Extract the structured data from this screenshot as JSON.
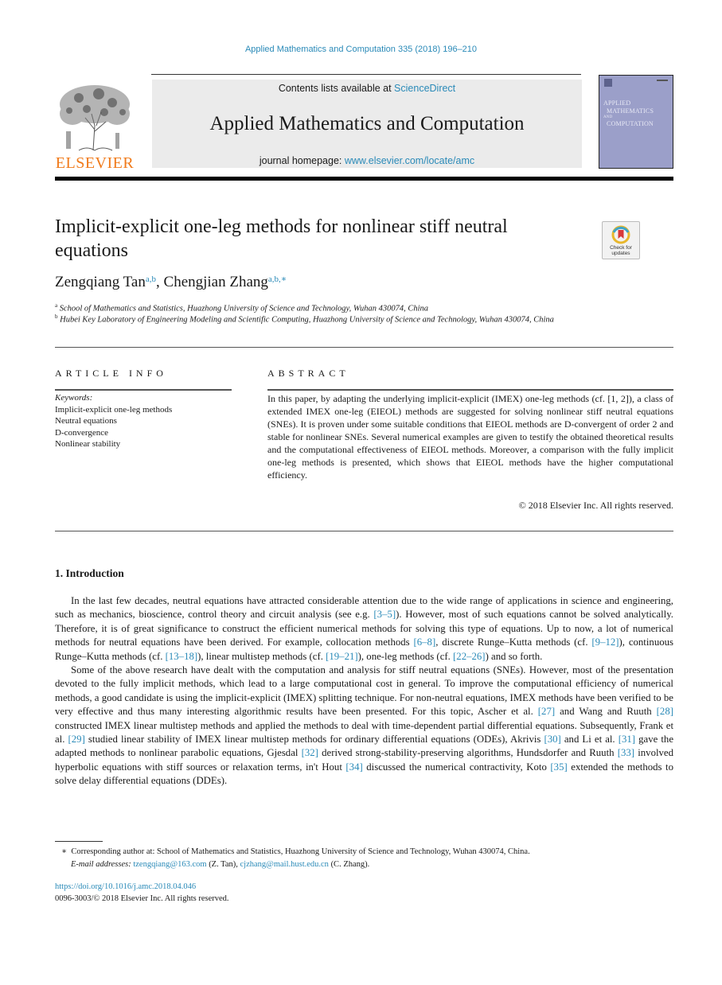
{
  "running_head": "Applied Mathematics and Computation 335 (2018) 196–210",
  "masthead": {
    "publisher_logo_text": "ELSEVIER",
    "contents_prefix": "Contents lists available at ",
    "contents_link": "ScienceDirect",
    "journal_title": "Applied Mathematics and Computation",
    "homepage_prefix": "journal homepage: ",
    "homepage_link": "www.elsevier.com/locate/amc",
    "cover_title_lines": [
      "APPLIED",
      "MATHEMATICS",
      "AND",
      "COMPUTATION"
    ]
  },
  "article": {
    "title": "Implicit-explicit one-leg methods for nonlinear stiff neutral equations",
    "crossmark_label": "Check for updates",
    "authors": [
      {
        "name": "Zengqiang Tan",
        "marks": "a,b"
      },
      {
        "name": "Chengjian Zhang",
        "marks": "a,b,∗"
      }
    ],
    "author_separator": ", ",
    "affiliations": [
      {
        "mark": "a",
        "text": "School of Mathematics and Statistics, Huazhong University of Science and Technology, Wuhan 430074, China"
      },
      {
        "mark": "b",
        "text": "Hubei Key Laboratory of Engineering Modeling and Scientific Computing, Huazhong University of Science and Technology, Wuhan 430074, China"
      }
    ]
  },
  "article_info": {
    "heading": "ARTICLE INFO",
    "keywords_label": "Keywords:",
    "keywords": [
      "Implicit-explicit one-leg methods",
      "Neutral equations",
      "D-convergence",
      "Nonlinear stability"
    ]
  },
  "abstract": {
    "heading": "ABSTRACT",
    "text": "In this paper, by adapting the underlying implicit-explicit (IMEX) one-leg methods (cf. [1, 2]), a class of extended IMEX one-leg (EIEOL) methods are suggested for solving nonlinear stiff neutral equations (SNEs). It is proven under some suitable conditions that EIEOL methods are D-convergent of order 2 and stable for nonlinear SNEs. Several numerical examples are given to testify the obtained theoretical results and the computational effectiveness of EIEOL methods. Moreover, a comparison with the fully implicit one-leg methods is presented, which shows that EIEOL methods have the higher computational efficiency.",
    "copyright": "© 2018 Elsevier Inc. All rights reserved."
  },
  "introduction": {
    "heading": "1. Introduction",
    "paragraphs": [
      [
        {
          "t": "In the last few decades, neutral equations have attracted considerable attention due to the wide range of applications in science and engineering, such as mechanics, bioscience, control theory and circuit analysis (see e.g. "
        },
        {
          "t": "[3–5]",
          "link": true
        },
        {
          "t": "). However, most of such equations cannot be solved analytically. Therefore, it is of great significance to construct the efficient numerical methods for solving this type of equations. Up to now, a lot of numerical methods for neutral equations have been derived. For example, collocation methods "
        },
        {
          "t": "[6–8]",
          "link": true
        },
        {
          "t": ", discrete Runge–Kutta methods (cf. "
        },
        {
          "t": "[9–12]",
          "link": true
        },
        {
          "t": "), continuous Runge–Kutta methods (cf. "
        },
        {
          "t": "[13–18]",
          "link": true
        },
        {
          "t": "), linear multistep methods (cf. "
        },
        {
          "t": "[19–21]",
          "link": true
        },
        {
          "t": "), one-leg methods (cf. "
        },
        {
          "t": "[22–26]",
          "link": true
        },
        {
          "t": ") and so forth."
        }
      ],
      [
        {
          "t": "Some of the above research have dealt with the computation and analysis for stiff neutral equations (SNEs). However, most of the presentation devoted to the fully implicit methods, which lead to a large computational cost in general. To improve the computational efficiency of numerical methods, a good candidate is using the implicit-explicit (IMEX) splitting technique. For non-neutral equations, IMEX methods have been verified to be very effective and thus many interesting algorithmic results have been presented. For this topic, Ascher et al. "
        },
        {
          "t": "[27]",
          "link": true
        },
        {
          "t": " and Wang and Ruuth "
        },
        {
          "t": "[28]",
          "link": true
        },
        {
          "t": " constructed IMEX linear multistep methods and applied the methods to deal with time-dependent partial differential equations. Subsequently, Frank et al. "
        },
        {
          "t": "[29]",
          "link": true
        },
        {
          "t": " studied linear stability of IMEX linear multistep methods for ordinary differential equations (ODEs), Akrivis "
        },
        {
          "t": "[30]",
          "link": true
        },
        {
          "t": " and Li et al. "
        },
        {
          "t": "[31]",
          "link": true
        },
        {
          "t": " gave the adapted methods to nonlinear parabolic equations, Gjesdal "
        },
        {
          "t": "[32]",
          "link": true
        },
        {
          "t": " derived strong-stability-preserving algorithms, Hundsdorfer and Ruuth "
        },
        {
          "t": "[33]",
          "link": true
        },
        {
          "t": " involved hyperbolic equations with stiff sources or relaxation terms, in't Hout "
        },
        {
          "t": "[34]",
          "link": true
        },
        {
          "t": " discussed the numerical contractivity, Koto "
        },
        {
          "t": "[35]",
          "link": true
        },
        {
          "t": " extended the methods to solve delay differential equations (DDEs)."
        }
      ]
    ]
  },
  "footnotes": {
    "corresponding_mark": "∗",
    "corresponding_text": "Corresponding author at: School of Mathematics and Statistics, Huazhong University of Science and Technology, Wuhan 430074, China.",
    "email_label": "E-mail addresses: ",
    "emails": [
      {
        "address": "tzengqiang@163.com",
        "who": " (Z. Tan), "
      },
      {
        "address": "cjzhang@mail.hust.edu.cn",
        "who": " (C. Zhang)."
      }
    ]
  },
  "doi": "https://doi.org/10.1016/j.amc.2018.04.046",
  "issn_line": "0096-3003/© 2018 Elsevier Inc. All rights reserved."
}
